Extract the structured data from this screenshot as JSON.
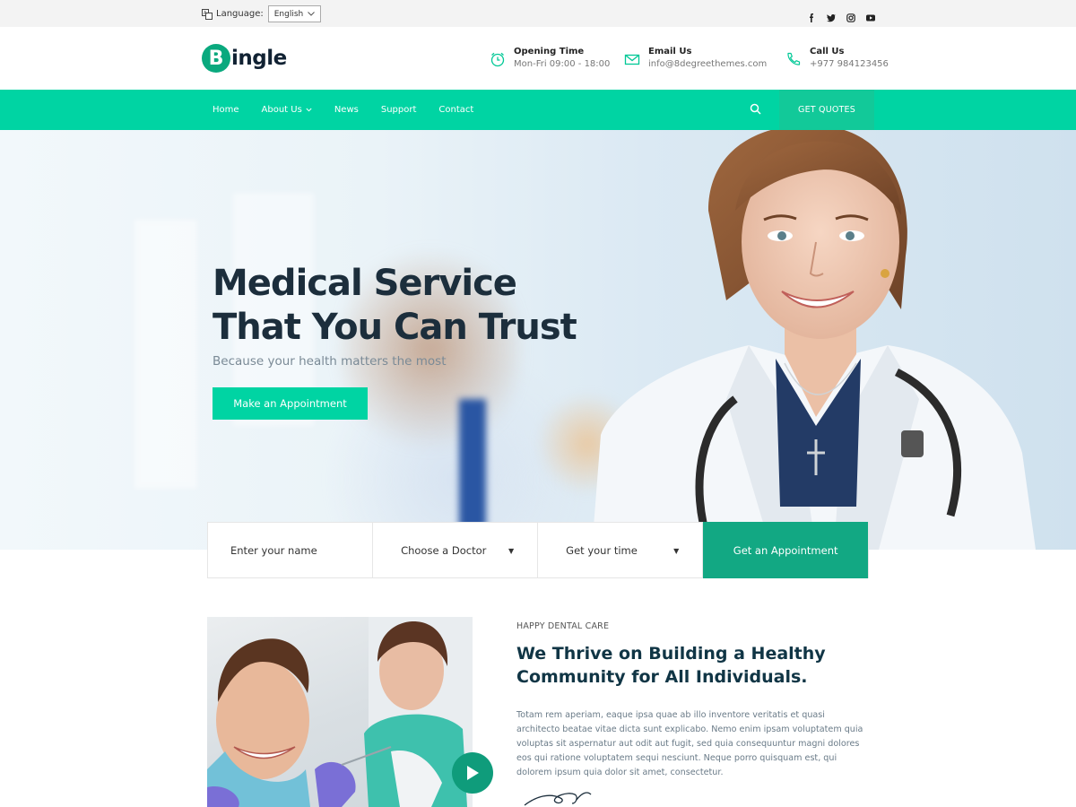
{
  "topbar": {
    "language_label": "Language:",
    "language_value": "English",
    "socials": [
      "facebook-icon",
      "twitter-icon",
      "instagram-icon",
      "youtube-icon"
    ]
  },
  "header": {
    "logo_letter": "B",
    "logo_text": "ingle",
    "info": [
      {
        "icon": "clock-icon",
        "title": "Opening Time",
        "value": "Mon-Fri 09:00 - 18:00"
      },
      {
        "icon": "mail-icon",
        "title": "Email Us",
        "value": "info@8degreethemes.com"
      },
      {
        "icon": "phone-icon",
        "title": "Call Us",
        "value": "+977 984123456"
      }
    ]
  },
  "nav": {
    "items": [
      "Home",
      "About Us",
      "News",
      "Support",
      "Contact"
    ],
    "quotes_label": "GET QUOTES"
  },
  "hero": {
    "title_line1": "Medical Service",
    "title_line2": "That You Can Trust",
    "subtitle": "Because your health matters the most",
    "button": "Make an Appointment"
  },
  "appointment": {
    "name_placeholder": "Enter your name",
    "doctor_select": "Choose a Doctor",
    "time_select": "Get your time",
    "button": "Get an Appointment"
  },
  "about": {
    "kicker": "HAPPY DENTAL CARE",
    "title": "We Thrive on Building a Healthy Community for All Individuals.",
    "text": "Totam rem aperiam, eaque ipsa quae ab illo inventore veritatis et quasi architecto beatae vitae dicta sunt explicabo. Nemo enim ipsam voluptatem quia voluptas sit aspernatur aut odit aut fugit, sed quia consequuntur magni dolores eos qui ratione voluptatem sequi nesciunt. Neque porro quisquam est, qui dolorem ipsum quia dolor sit amet, consectetur."
  },
  "colors": {
    "accent": "#00d4a3",
    "accent_dark": "#12a883",
    "heading": "#1c2e3c"
  }
}
